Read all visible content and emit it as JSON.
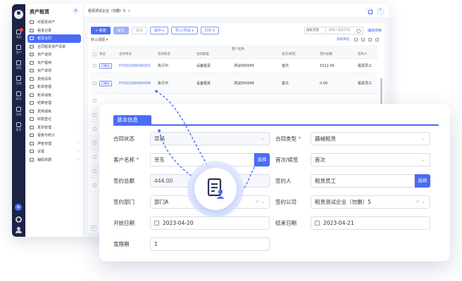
{
  "colors": {
    "accent": "#4a6cf7",
    "rail": "#1d2345",
    "required": "#f5483b"
  },
  "rail": {
    "items": [
      {
        "icon": "message-icon",
        "label": "消息"
      },
      {
        "icon": "asset-icon",
        "label": "资产"
      },
      {
        "icon": "purchase-icon",
        "label": "采购"
      },
      {
        "icon": "warehouse-icon",
        "label": "仓储"
      },
      {
        "icon": "finance-icon",
        "label": "财务"
      },
      {
        "icon": "maintenance-icon",
        "label": "运维"
      },
      {
        "icon": "more-icon",
        "label": "更多"
      }
    ]
  },
  "sidebar": {
    "title": "资产租赁",
    "items": [
      {
        "label": "可租赁资产"
      },
      {
        "label": "租赁记录"
      },
      {
        "label": "租赁合同",
        "active": true
      },
      {
        "label": "合同租赁资产清单"
      },
      {
        "label": "资产退场"
      },
      {
        "label": "资产报停"
      },
      {
        "label": "资产退场"
      },
      {
        "label": "费用清单"
      },
      {
        "label": "账单管理"
      },
      {
        "label": "账单减免"
      },
      {
        "label": "结算管理"
      },
      {
        "label": "费用减免"
      },
      {
        "label": "收款登记"
      },
      {
        "label": "发票管理"
      },
      {
        "label": "报表与统计"
      },
      {
        "label": "押金管理",
        "arrow": "›"
      },
      {
        "label": "设置",
        "arrow": "›"
      },
      {
        "label": "辅助单据",
        "arrow": "›"
      }
    ]
  },
  "topbar": {
    "tab": "租赁测试企业（勿删）5",
    "close": "×"
  },
  "toolbar": {
    "new": "+ 新建",
    "submit": "提交",
    "edit": "编辑",
    "operate": "操作 ▾",
    "import_export": "导入/导出 ▾",
    "print": "打印 ▾",
    "search_scope": "搜索范围",
    "search_placeholder": "请输入搜索内容",
    "sql_search": "编辑搜索"
  },
  "subbar": {
    "view": "默认视图 ▾",
    "filter": "高级筛选"
  },
  "table": {
    "group_header": "客户名称",
    "columns": [
      "状态",
      "合同单号",
      "合同状态",
      "合同类型",
      "",
      "首次/续签",
      "签约总额",
      "签约人"
    ],
    "rows": [
      {
        "tag": "已确认",
        "no": "HT202306090001",
        "status": "执行中",
        "type": "设备租赁",
        "customer": "测试000045",
        "renew": "首次",
        "amount": "1512.00",
        "signer": "租赁员工"
      },
      {
        "tag": "已确认",
        "no": "HT202306080009",
        "status": "执行中",
        "type": "设备租赁",
        "customer": "测试000045",
        "renew": "首次",
        "amount": "0.00",
        "signer": "租赁员工"
      }
    ],
    "empty_rows": 7,
    "scroll_left": "‹"
  },
  "form": {
    "section_title": "基本信息",
    "fields": {
      "contract_status": {
        "label": "合同状态",
        "value": "草稿"
      },
      "contract_type": {
        "label": "合同类型",
        "value": "器械租赁",
        "required": "*"
      },
      "customer_name": {
        "label": "客户名称",
        "value": "京东",
        "required": "*",
        "button": "选择"
      },
      "renewal": {
        "label": "首次/续签",
        "value": "首次"
      },
      "total_amount": {
        "label": "签约总额",
        "value": "444.00"
      },
      "signer": {
        "label": "签约人",
        "value": "租赁员工",
        "button": "选择"
      },
      "department": {
        "label": "签约部门",
        "value": "部门A"
      },
      "company": {
        "label": "签约公司",
        "value": "租赁测试企业（勿删）5"
      },
      "start_date": {
        "label": "开始日期",
        "value": "2023-04-20"
      },
      "end_date": {
        "label": "结束日期",
        "value": "2023-04-21"
      },
      "grace_period": {
        "label": "宽限期",
        "value": "1"
      }
    }
  },
  "center_icon": "contract-user-icon"
}
